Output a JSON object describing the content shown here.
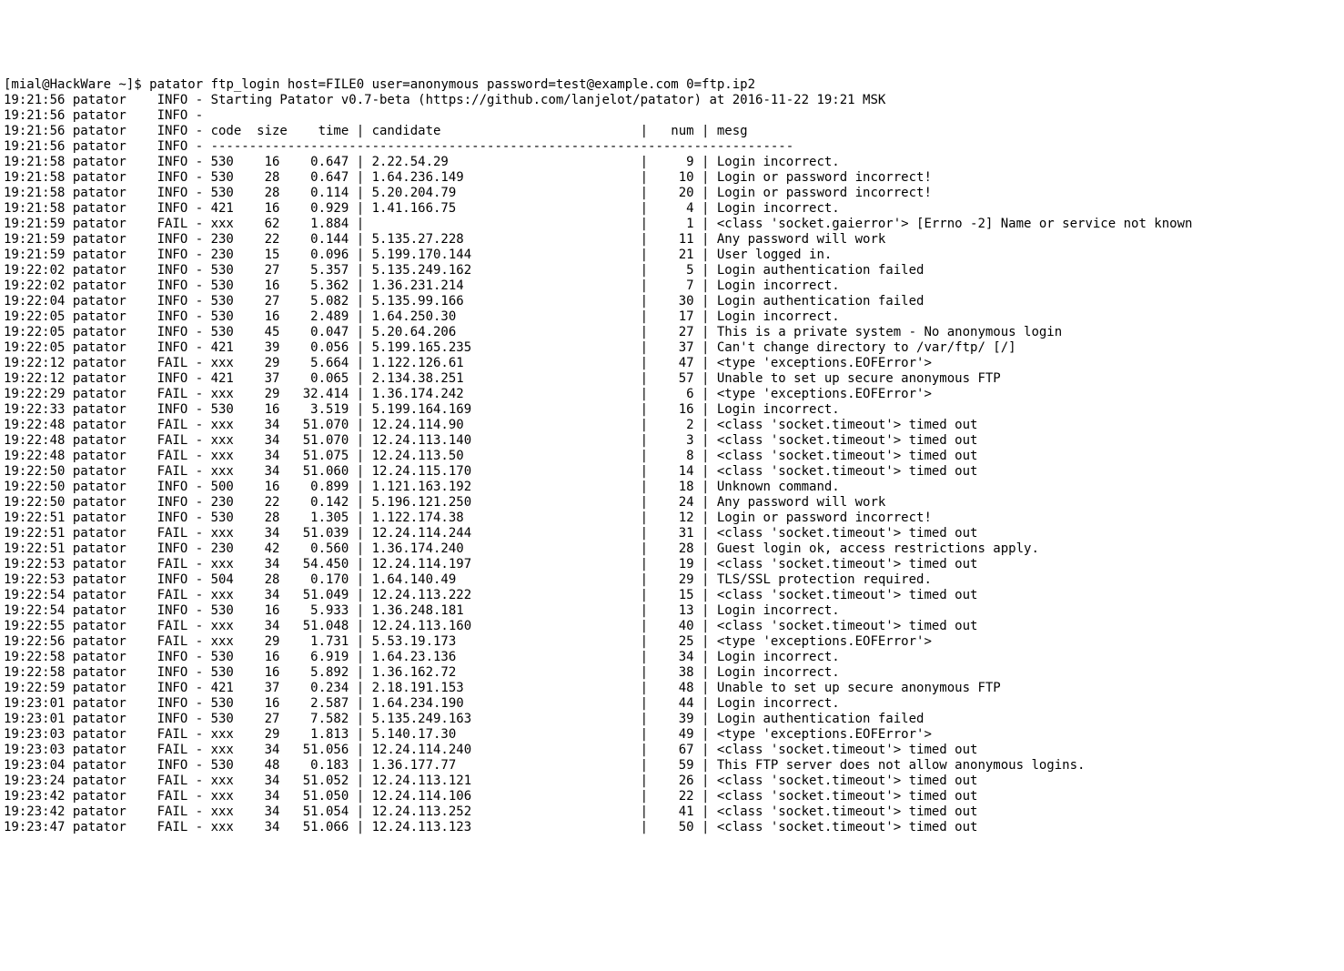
{
  "prompt": "[mial@HackWare ~]$ ",
  "command": "patator ftp_login host=FILE0 user=anonymous password=test@example.com 0=ftp.ip2",
  "startLine": "19:21:56 patator    INFO - Starting Patator v0.7-beta (https://github.com/lanjelot/patator) at 2016-11-22 19:21 MSK",
  "blankInfo": "19:21:56 patator    INFO -",
  "headerLine": "19:21:56 patator    INFO - code  size    time | candidate                          |   num | mesg",
  "dashes": "19:21:56 patator    INFO - ----------------------------------------------------------------------------",
  "rows": [
    {
      "t": "19:21:58",
      "lv": "INFO",
      "code": "530",
      "size": "16",
      "time": "0.647",
      "cand": "2.22.54.29",
      "num": "9",
      "mesg": "Login incorrect."
    },
    {
      "t": "19:21:58",
      "lv": "INFO",
      "code": "530",
      "size": "28",
      "time": "0.647",
      "cand": "1.64.236.149",
      "num": "10",
      "mesg": "Login or password incorrect!"
    },
    {
      "t": "19:21:58",
      "lv": "INFO",
      "code": "530",
      "size": "28",
      "time": "0.114",
      "cand": "5.20.204.79",
      "num": "20",
      "mesg": "Login or password incorrect!"
    },
    {
      "t": "19:21:58",
      "lv": "INFO",
      "code": "421",
      "size": "16",
      "time": "0.929",
      "cand": "1.41.166.75",
      "num": "4",
      "mesg": "Login incorrect."
    },
    {
      "t": "19:21:59",
      "lv": "FAIL",
      "code": "xxx",
      "size": "62",
      "time": "1.884",
      "cand": "",
      "num": "1",
      "mesg": "<class 'socket.gaierror'> [Errno -2] Name or service not known"
    },
    {
      "t": "19:21:59",
      "lv": "INFO",
      "code": "230",
      "size": "22",
      "time": "0.144",
      "cand": "5.135.27.228",
      "num": "11",
      "mesg": "Any password will work"
    },
    {
      "t": "19:21:59",
      "lv": "INFO",
      "code": "230",
      "size": "15",
      "time": "0.096",
      "cand": "5.199.170.144",
      "num": "21",
      "mesg": "User logged in."
    },
    {
      "t": "19:22:02",
      "lv": "INFO",
      "code": "530",
      "size": "27",
      "time": "5.357",
      "cand": "5.135.249.162",
      "num": "5",
      "mesg": "Login authentication failed"
    },
    {
      "t": "19:22:02",
      "lv": "INFO",
      "code": "530",
      "size": "16",
      "time": "5.362",
      "cand": "1.36.231.214",
      "num": "7",
      "mesg": "Login incorrect."
    },
    {
      "t": "19:22:04",
      "lv": "INFO",
      "code": "530",
      "size": "27",
      "time": "5.082",
      "cand": "5.135.99.166",
      "num": "30",
      "mesg": "Login authentication failed"
    },
    {
      "t": "19:22:05",
      "lv": "INFO",
      "code": "530",
      "size": "16",
      "time": "2.489",
      "cand": "1.64.250.30",
      "num": "17",
      "mesg": "Login incorrect."
    },
    {
      "t": "19:22:05",
      "lv": "INFO",
      "code": "530",
      "size": "45",
      "time": "0.047",
      "cand": "5.20.64.206",
      "num": "27",
      "mesg": "This is a private system - No anonymous login"
    },
    {
      "t": "19:22:05",
      "lv": "INFO",
      "code": "421",
      "size": "39",
      "time": "0.056",
      "cand": "5.199.165.235",
      "num": "37",
      "mesg": "Can't change directory to /var/ftp/ [/]"
    },
    {
      "t": "19:22:12",
      "lv": "FAIL",
      "code": "xxx",
      "size": "29",
      "time": "5.664",
      "cand": "1.122.126.61",
      "num": "47",
      "mesg": "<type 'exceptions.EOFError'>"
    },
    {
      "t": "19:22:12",
      "lv": "INFO",
      "code": "421",
      "size": "37",
      "time": "0.065",
      "cand": "2.134.38.251",
      "num": "57",
      "mesg": "Unable to set up secure anonymous FTP"
    },
    {
      "t": "19:22:29",
      "lv": "FAIL",
      "code": "xxx",
      "size": "29",
      "time": "32.414",
      "cand": "1.36.174.242",
      "num": "6",
      "mesg": "<type 'exceptions.EOFError'>"
    },
    {
      "t": "19:22:33",
      "lv": "INFO",
      "code": "530",
      "size": "16",
      "time": "3.519",
      "cand": "5.199.164.169",
      "num": "16",
      "mesg": "Login incorrect."
    },
    {
      "t": "19:22:48",
      "lv": "FAIL",
      "code": "xxx",
      "size": "34",
      "time": "51.070",
      "cand": "12.24.114.90",
      "num": "2",
      "mesg": "<class 'socket.timeout'> timed out"
    },
    {
      "t": "19:22:48",
      "lv": "FAIL",
      "code": "xxx",
      "size": "34",
      "time": "51.070",
      "cand": "12.24.113.140",
      "num": "3",
      "mesg": "<class 'socket.timeout'> timed out"
    },
    {
      "t": "19:22:48",
      "lv": "FAIL",
      "code": "xxx",
      "size": "34",
      "time": "51.075",
      "cand": "12.24.113.50",
      "num": "8",
      "mesg": "<class 'socket.timeout'> timed out"
    },
    {
      "t": "19:22:50",
      "lv": "FAIL",
      "code": "xxx",
      "size": "34",
      "time": "51.060",
      "cand": "12.24.115.170",
      "num": "14",
      "mesg": "<class 'socket.timeout'> timed out"
    },
    {
      "t": "19:22:50",
      "lv": "INFO",
      "code": "500",
      "size": "16",
      "time": "0.899",
      "cand": "1.121.163.192",
      "num": "18",
      "mesg": "Unknown command."
    },
    {
      "t": "19:22:50",
      "lv": "INFO",
      "code": "230",
      "size": "22",
      "time": "0.142",
      "cand": "5.196.121.250",
      "num": "24",
      "mesg": "Any password will work"
    },
    {
      "t": "19:22:51",
      "lv": "INFO",
      "code": "530",
      "size": "28",
      "time": "1.305",
      "cand": "1.122.174.38",
      "num": "12",
      "mesg": "Login or password incorrect!"
    },
    {
      "t": "19:22:51",
      "lv": "FAIL",
      "code": "xxx",
      "size": "34",
      "time": "51.039",
      "cand": "12.24.114.244",
      "num": "31",
      "mesg": "<class 'socket.timeout'> timed out"
    },
    {
      "t": "19:22:51",
      "lv": "INFO",
      "code": "230",
      "size": "42",
      "time": "0.560",
      "cand": "1.36.174.240",
      "num": "28",
      "mesg": "Guest login ok, access restrictions apply."
    },
    {
      "t": "19:22:53",
      "lv": "FAIL",
      "code": "xxx",
      "size": "34",
      "time": "54.450",
      "cand": "12.24.114.197",
      "num": "19",
      "mesg": "<class 'socket.timeout'> timed out"
    },
    {
      "t": "19:22:53",
      "lv": "INFO",
      "code": "504",
      "size": "28",
      "time": "0.170",
      "cand": "1.64.140.49",
      "num": "29",
      "mesg": "TLS/SSL protection required."
    },
    {
      "t": "19:22:54",
      "lv": "FAIL",
      "code": "xxx",
      "size": "34",
      "time": "51.049",
      "cand": "12.24.113.222",
      "num": "15",
      "mesg": "<class 'socket.timeout'> timed out"
    },
    {
      "t": "19:22:54",
      "lv": "INFO",
      "code": "530",
      "size": "16",
      "time": "5.933",
      "cand": "1.36.248.181",
      "num": "13",
      "mesg": "Login incorrect."
    },
    {
      "t": "19:22:55",
      "lv": "FAIL",
      "code": "xxx",
      "size": "34",
      "time": "51.048",
      "cand": "12.24.113.160",
      "num": "40",
      "mesg": "<class 'socket.timeout'> timed out"
    },
    {
      "t": "19:22:56",
      "lv": "FAIL",
      "code": "xxx",
      "size": "29",
      "time": "1.731",
      "cand": "5.53.19.173",
      "num": "25",
      "mesg": "<type 'exceptions.EOFError'>"
    },
    {
      "t": "19:22:58",
      "lv": "INFO",
      "code": "530",
      "size": "16",
      "time": "6.919",
      "cand": "1.64.23.136",
      "num": "34",
      "mesg": "Login incorrect."
    },
    {
      "t": "19:22:58",
      "lv": "INFO",
      "code": "530",
      "size": "16",
      "time": "5.892",
      "cand": "1.36.162.72",
      "num": "38",
      "mesg": "Login incorrect."
    },
    {
      "t": "19:22:59",
      "lv": "INFO",
      "code": "421",
      "size": "37",
      "time": "0.234",
      "cand": "2.18.191.153",
      "num": "48",
      "mesg": "Unable to set up secure anonymous FTP"
    },
    {
      "t": "19:23:01",
      "lv": "INFO",
      "code": "530",
      "size": "16",
      "time": "2.587",
      "cand": "1.64.234.190",
      "num": "44",
      "mesg": "Login incorrect."
    },
    {
      "t": "19:23:01",
      "lv": "INFO",
      "code": "530",
      "size": "27",
      "time": "7.582",
      "cand": "5.135.249.163",
      "num": "39",
      "mesg": "Login authentication failed"
    },
    {
      "t": "19:23:03",
      "lv": "FAIL",
      "code": "xxx",
      "size": "29",
      "time": "1.813",
      "cand": "5.140.17.30",
      "num": "49",
      "mesg": "<type 'exceptions.EOFError'>"
    },
    {
      "t": "19:23:03",
      "lv": "FAIL",
      "code": "xxx",
      "size": "34",
      "time": "51.056",
      "cand": "12.24.114.240",
      "num": "67",
      "mesg": "<class 'socket.timeout'> timed out"
    },
    {
      "t": "19:23:04",
      "lv": "INFO",
      "code": "530",
      "size": "48",
      "time": "0.183",
      "cand": "1.36.177.77",
      "num": "59",
      "mesg": "This FTP server does not allow anonymous logins."
    },
    {
      "t": "19:23:24",
      "lv": "FAIL",
      "code": "xxx",
      "size": "34",
      "time": "51.052",
      "cand": "12.24.113.121",
      "num": "26",
      "mesg": "<class 'socket.timeout'> timed out"
    },
    {
      "t": "19:23:42",
      "lv": "FAIL",
      "code": "xxx",
      "size": "34",
      "time": "51.050",
      "cand": "12.24.114.106",
      "num": "22",
      "mesg": "<class 'socket.timeout'> timed out"
    },
    {
      "t": "19:23:42",
      "lv": "FAIL",
      "code": "xxx",
      "size": "34",
      "time": "51.054",
      "cand": "12.24.113.252",
      "num": "41",
      "mesg": "<class 'socket.timeout'> timed out"
    },
    {
      "t": "19:23:47",
      "lv": "FAIL",
      "code": "xxx",
      "size": "34",
      "time": "51.066",
      "cand": "12.24.113.123",
      "num": "50",
      "mesg": "<class 'socket.timeout'> timed out"
    }
  ]
}
